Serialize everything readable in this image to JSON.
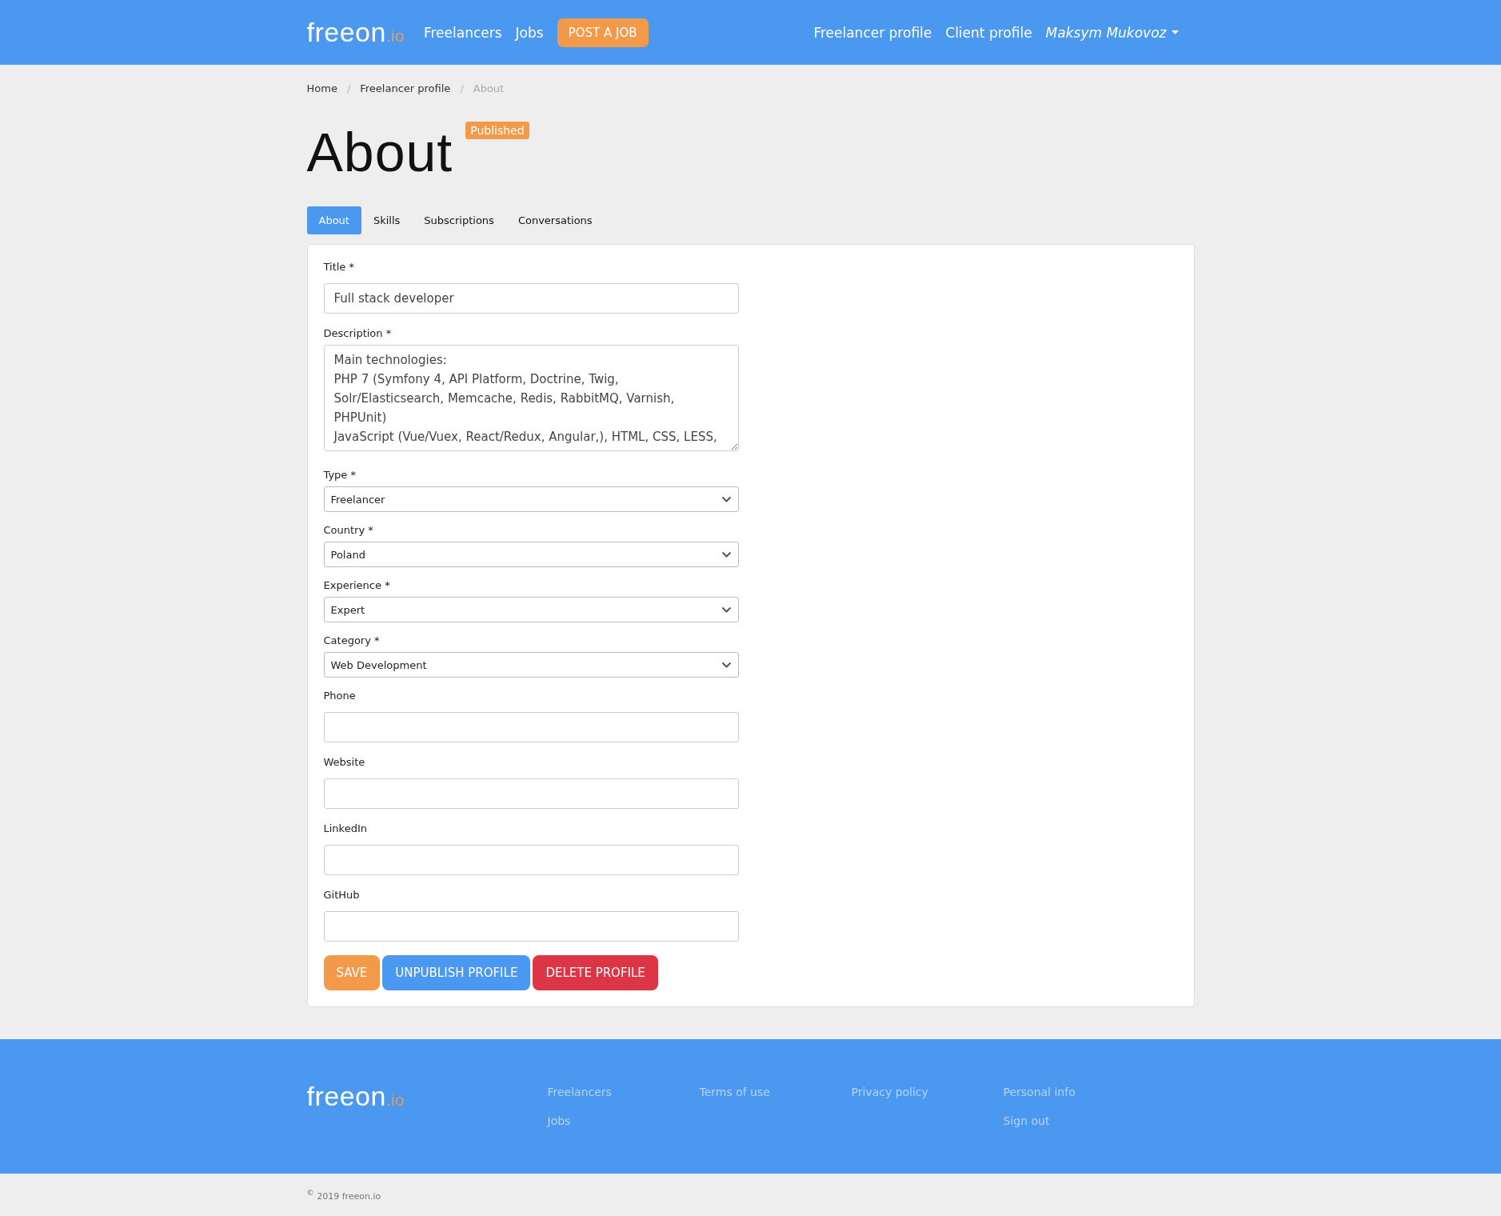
{
  "header": {
    "logo": {
      "text": "freeon",
      "suffix": ".io"
    },
    "nav": [
      "Freelancers",
      "Jobs"
    ],
    "post_button": "POST A JOB",
    "right_nav": [
      "Freelancer profile",
      "Client profile"
    ],
    "user": {
      "name": "Maksym Mukovoz"
    }
  },
  "breadcrumb_separator": "/",
  "breadcrumb": [
    {
      "label": "Home",
      "active": false
    },
    {
      "label": "Freelancer profile",
      "active": false
    },
    {
      "label": "About",
      "active": true
    }
  ],
  "page_title": "About",
  "status_badge": "Published",
  "tabs": [
    {
      "label": "About",
      "selected": true
    },
    {
      "label": "Skills",
      "selected": false
    },
    {
      "label": "Subscriptions",
      "selected": false
    },
    {
      "label": "Conversations",
      "selected": false
    }
  ],
  "form": {
    "fields": [
      {
        "kind": "input",
        "label": "Title *",
        "value": "Full stack developer"
      },
      {
        "kind": "textarea",
        "label": "Description *",
        "value": "Main technologies:\nPHP 7 (Symfony 4, API Platform, Doctrine, Twig, Solr/Elasticsearch, Memcache, Redis, RabbitMQ, Varnish, PHPUnit)\nJavaScript (Vue/Vuex, React/Redux, Angular,), HTML, CSS, LESS,"
      },
      {
        "kind": "select",
        "label": "Type *",
        "value": "Freelancer"
      },
      {
        "kind": "select",
        "label": "Country *",
        "value": "Poland"
      },
      {
        "kind": "select",
        "label": "Experience *",
        "value": "Expert"
      },
      {
        "kind": "select",
        "label": "Category *",
        "value": "Web Development"
      },
      {
        "kind": "input",
        "label": "Phone"
      },
      {
        "kind": "input",
        "label": "Website"
      },
      {
        "kind": "input",
        "label": "LinkedIn"
      },
      {
        "kind": "input",
        "label": "GitHub"
      }
    ],
    "buttons": [
      {
        "label": "SAVE",
        "kind": "warning"
      },
      {
        "label": "UNPUBLISH PROFILE",
        "kind": "primary"
      },
      {
        "label": "DELETE PROFILE",
        "kind": "danger"
      }
    ]
  },
  "footer": {
    "logo": {
      "text": "freeon",
      "suffix": ".io"
    },
    "columns": [
      [
        "Freelancers",
        "Jobs"
      ],
      [
        "Terms of use"
      ],
      [
        "Privacy policy"
      ],
      [
        "Personal info",
        "Sign out"
      ]
    ]
  },
  "copyright": "$^{©}$ 2019 freeon.io"
}
